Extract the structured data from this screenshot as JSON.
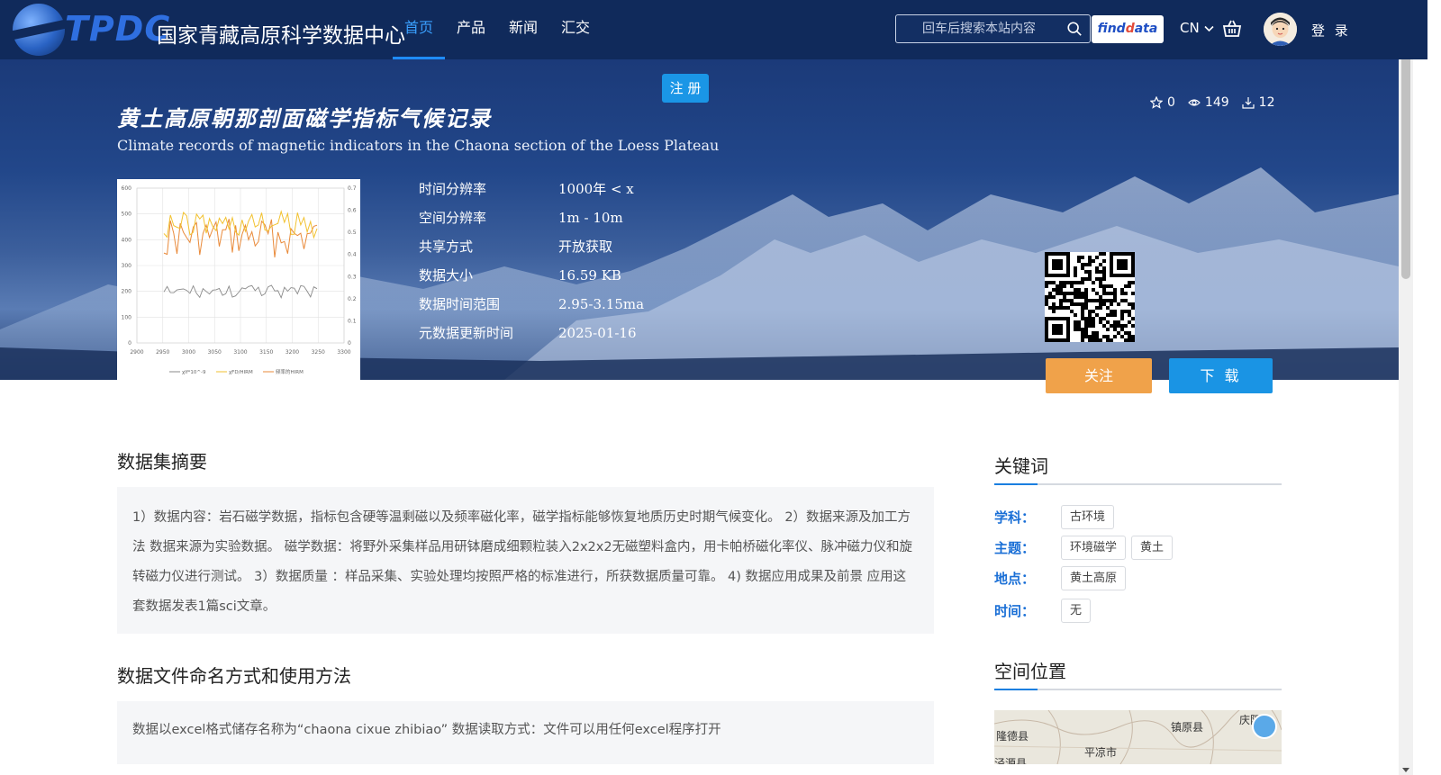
{
  "header": {
    "logo_en": "TPDC",
    "logo_cn": "国家青藏高原科学数据中心",
    "nav": [
      {
        "label": "首页",
        "active": true
      },
      {
        "label": "产品"
      },
      {
        "label": "新闻"
      },
      {
        "label": "汇交"
      }
    ],
    "search_placeholder": "回车后搜索本站内容",
    "findata_label_a": "find",
    "findata_label_b": "ata",
    "findata_label_d": "d",
    "lang": "CN",
    "login": "登 录"
  },
  "hero": {
    "register": "注 册",
    "title_cn": "黄土高原朝那剖面磁学指标气候记录",
    "title_en": "Climate records of magnetic indicators in the Chaona section of the Loess Plateau",
    "stats": {
      "stars": "0",
      "views": "149",
      "downloads": "12"
    },
    "meta": [
      {
        "k": "时间分辨率",
        "v": "1000年 < x"
      },
      {
        "k": "空间分辨率",
        "v": "1m - 10m"
      },
      {
        "k": "共享方式",
        "v": "开放获取"
      },
      {
        "k": "数据大小",
        "v": "16.59 KB"
      },
      {
        "k": "数据时间范围",
        "v": "2.95-3.15ma"
      },
      {
        "k": "元数据更新时间",
        "v": "2025-01-16"
      }
    ],
    "follow": "关注",
    "download": "下 载"
  },
  "thumbnail_chart": {
    "x_ticks": [
      "2900",
      "2950",
      "3000",
      "3050",
      "3100",
      "3150",
      "3200",
      "3250",
      "3300"
    ],
    "y_left_ticks": [
      "0",
      "100",
      "200",
      "300",
      "400",
      "500",
      "600"
    ],
    "y_right_ticks": [
      "0",
      "0.1",
      "0.2",
      "0.3",
      "0.4",
      "0.5",
      "0.6",
      "0.7"
    ],
    "legend": [
      "χlf*10^-9",
      "χFD/HIRM",
      "频率的HIRM"
    ],
    "colors": {
      "gray": "#8a8a8a",
      "yellow": "#f2c230",
      "orange": "#e98a3a"
    }
  },
  "main": {
    "abstract_title": "数据集摘要",
    "abstract": "1）数据内容：岩石磁学数据，指标包含硬等温剩磁以及频率磁化率，磁学指标能够恢复地质历史时期气候变化。 2）数据来源及加工方法 数据来源为实验数据。 磁学数据：将野外采集样品用研钵磨成细颗粒装入2x2x2无磁塑料盒内，用卡帕桥磁化率仪、脉冲磁力仪和旋转磁力仪进行测试。 3）数据质量 ：样品采集、实验处理均按照严格的标准进行，所获数据质量可靠。 4) 数据应用成果及前景 应用这套数据发表1篇sci文章。",
    "naming_title": "数据文件命名方式和使用方法",
    "naming": "数据以excel格式储存名称为“chaona cixue zhibiao” 数据读取方式：文件可以用任何excel程序打开"
  },
  "sidebar": {
    "keywords_title": "关键词",
    "rows": [
      {
        "label": "学科：",
        "tags": [
          "古环境"
        ]
      },
      {
        "label": "主题：",
        "tags": [
          "环境磁学",
          "黄土"
        ]
      },
      {
        "label": "地点：",
        "tags": [
          "黄土高原"
        ]
      },
      {
        "label": "时间：",
        "tags": [
          "无"
        ]
      }
    ],
    "location_title": "空间位置",
    "map_labels": [
      "隆德县",
      "平凉市",
      "镇原县",
      "庆阳市",
      "泾源县"
    ]
  },
  "colors": {
    "brand": "#102a5b",
    "accent": "#1a94e4",
    "follow": "#f0a24a"
  }
}
